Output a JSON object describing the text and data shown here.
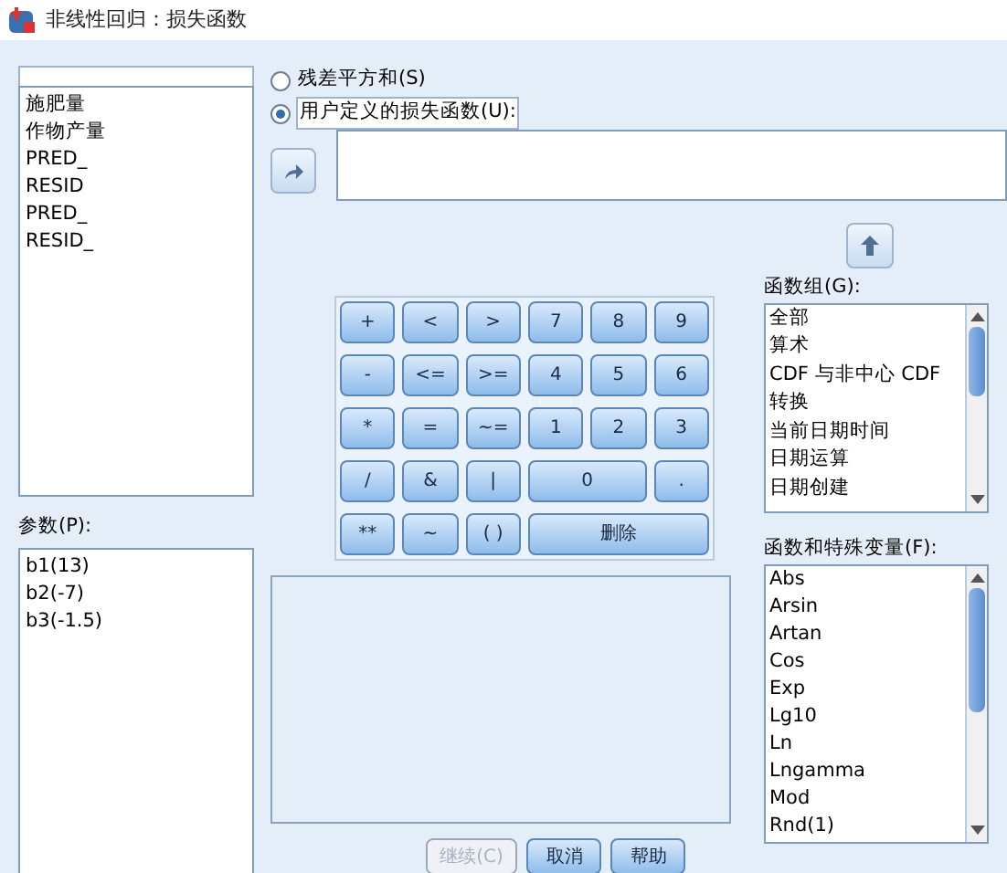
{
  "window": {
    "title": "非线性回归：损失函数"
  },
  "variables": {
    "items": [
      "施肥量",
      "作物产量",
      "PRED_",
      "RESID",
      "PRED_",
      "RESID_"
    ]
  },
  "parameters": {
    "label": "参数(P):",
    "items": [
      "b1(13)",
      "b2(-7)",
      "b3(-1.5)"
    ]
  },
  "loss_options": [
    {
      "label": "残差平方和(S)",
      "selected": false
    },
    {
      "label": "用户定义的损失函数(U):",
      "selected": true
    }
  ],
  "keypad": [
    {
      "label": "+",
      "kind": "single"
    },
    {
      "label": "<",
      "kind": "single"
    },
    {
      "label": ">",
      "kind": "single"
    },
    {
      "label": "7",
      "kind": "single"
    },
    {
      "label": "8",
      "kind": "single"
    },
    {
      "label": "9",
      "kind": "single"
    },
    {
      "label": "-",
      "kind": "single"
    },
    {
      "label": "<=",
      "kind": "single"
    },
    {
      "label": ">=",
      "kind": "single"
    },
    {
      "label": "4",
      "kind": "single"
    },
    {
      "label": "5",
      "kind": "single"
    },
    {
      "label": "6",
      "kind": "single"
    },
    {
      "label": "*",
      "kind": "single"
    },
    {
      "label": "=",
      "kind": "single"
    },
    {
      "label": "~=",
      "kind": "single"
    },
    {
      "label": "1",
      "kind": "single"
    },
    {
      "label": "2",
      "kind": "single"
    },
    {
      "label": "3",
      "kind": "single"
    },
    {
      "label": "/",
      "kind": "single"
    },
    {
      "label": "&",
      "kind": "single"
    },
    {
      "label": "|",
      "kind": "single"
    },
    {
      "label": "0",
      "kind": "double"
    },
    {
      "label": ".",
      "kind": "single"
    },
    {
      "label": "**",
      "kind": "single"
    },
    {
      "label": "~",
      "kind": "single"
    },
    {
      "label": "( )",
      "kind": "single"
    },
    {
      "label": "删除",
      "kind": "triple"
    }
  ],
  "function_groups": {
    "label": "函数组(G):",
    "items": [
      "全部",
      "算术",
      "CDF 与非中心 CDF",
      "转换",
      "当前日期时间",
      "日期运算",
      "日期创建"
    ]
  },
  "functions": {
    "label": "函数和特殊变量(F):",
    "items": [
      "Abs",
      "Arsin",
      "Artan",
      "Cos",
      "Exp",
      "Lg10",
      "Ln",
      "Lngamma",
      "Mod",
      "Rnd(1)"
    ]
  },
  "buttons": [
    {
      "label": "继续(C)",
      "disabled": true
    },
    {
      "label": "取消",
      "disabled": false
    },
    {
      "label": "帮助",
      "disabled": false
    }
  ]
}
